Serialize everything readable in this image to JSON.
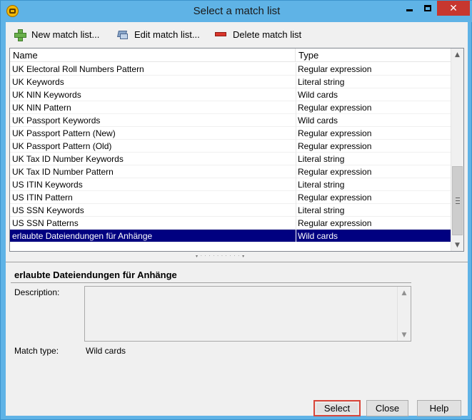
{
  "window": {
    "title": "Select a match list"
  },
  "toolbar": {
    "new_label": "New match list...",
    "edit_label": "Edit match list...",
    "delete_label": "Delete match list"
  },
  "list": {
    "columns": [
      "Name",
      "Type"
    ],
    "rows": [
      {
        "name": "UK Electoral Roll Numbers Pattern",
        "type": "Regular expression"
      },
      {
        "name": "UK Keywords",
        "type": "Literal string"
      },
      {
        "name": "UK NIN Keywords",
        "type": "Wild cards"
      },
      {
        "name": "UK NIN Pattern",
        "type": "Regular expression"
      },
      {
        "name": "UK Passport Keywords",
        "type": "Wild cards"
      },
      {
        "name": "UK Passport Pattern (New)",
        "type": "Regular expression"
      },
      {
        "name": "UK Passport Pattern (Old)",
        "type": "Regular expression"
      },
      {
        "name": "UK Tax ID Number Keywords",
        "type": "Literal string"
      },
      {
        "name": "UK Tax ID Number Pattern",
        "type": "Regular expression"
      },
      {
        "name": "US ITIN Keywords",
        "type": "Literal string"
      },
      {
        "name": "US ITIN Pattern",
        "type": "Regular expression"
      },
      {
        "name": "US SSN Keywords",
        "type": "Literal string"
      },
      {
        "name": "US SSN Patterns",
        "type": "Regular expression"
      },
      {
        "name": "erlaubte Dateiendungen für Anhänge",
        "type": "Wild cards"
      }
    ],
    "selected_index": 13,
    "selection_color": "#000080"
  },
  "details": {
    "title": "erlaubte Dateiendungen für Anhänge",
    "description_label": "Description:",
    "description_value": "",
    "match_type_label": "Match type:",
    "match_type_value": "Wild cards"
  },
  "buttons": {
    "select_label": "Select",
    "close_label": "Close",
    "help_label": "Help",
    "focus_color": "#d9463a"
  },
  "icons": {
    "app": "app-logo-icon",
    "new": "green-plus-icon",
    "edit": "edit-list-icon",
    "delete": "red-minus-icon"
  }
}
